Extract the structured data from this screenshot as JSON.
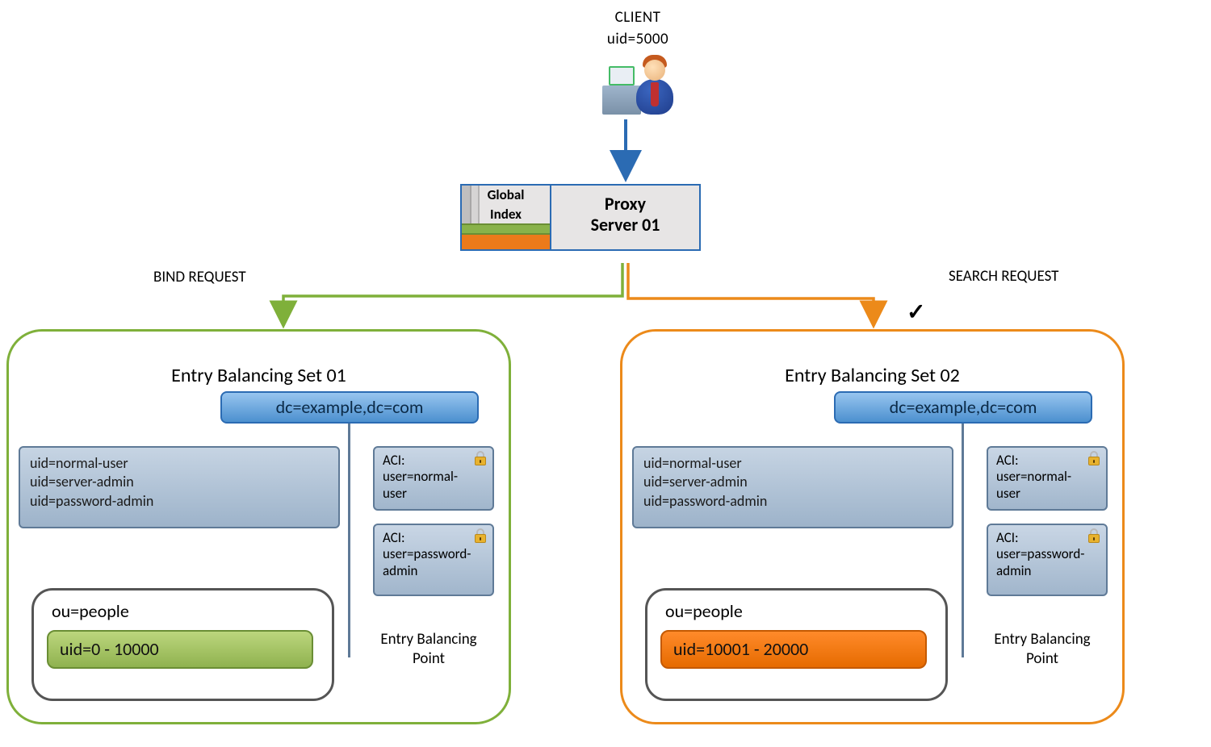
{
  "client": {
    "title": "CLIENT",
    "uid_line": "uid=5000"
  },
  "proxy": {
    "global_index_line1": "Global",
    "global_index_line2": "Index",
    "label_line1": "Proxy",
    "label_line2": "Server 01"
  },
  "requests": {
    "bind": "BIND REQUEST",
    "search": "SEARCH REQUEST",
    "check": "✓"
  },
  "set1": {
    "title": "Entry Balancing Set 01",
    "dc": "dc=example,dc=com",
    "uids": {
      "a": "uid=normal-user",
      "b": "uid=server-admin",
      "c": "uid=password-admin"
    },
    "aci1": {
      "l1": "ACI:",
      "l2": "user=normal-",
      "l3": "user"
    },
    "aci2": {
      "l1": "ACI:",
      "l2": "user=password-",
      "l3": "admin"
    },
    "eb_point_l1": "Entry Balancing",
    "eb_point_l2": "Point",
    "ou_label": "ou=people",
    "uid_pill": "uid=0 - 10000"
  },
  "set2": {
    "title": "Entry Balancing Set 02",
    "dc": "dc=example,dc=com",
    "uids": {
      "a": "uid=normal-user",
      "b": "uid=server-admin",
      "c": "uid=password-admin"
    },
    "aci1": {
      "l1": "ACI:",
      "l2": "user=normal-",
      "l3": "user"
    },
    "aci2": {
      "l1": "ACI:",
      "l2": "user=password-",
      "l3": "admin"
    },
    "eb_point_l1": "Entry Balancing",
    "eb_point_l2": "Point",
    "ou_label": "ou=people",
    "uid_pill": "uid=10001 - 20000"
  },
  "colors": {
    "blue": "#2b6bb3",
    "green": "#7fb03a",
    "orange": "#ec8a1a"
  }
}
